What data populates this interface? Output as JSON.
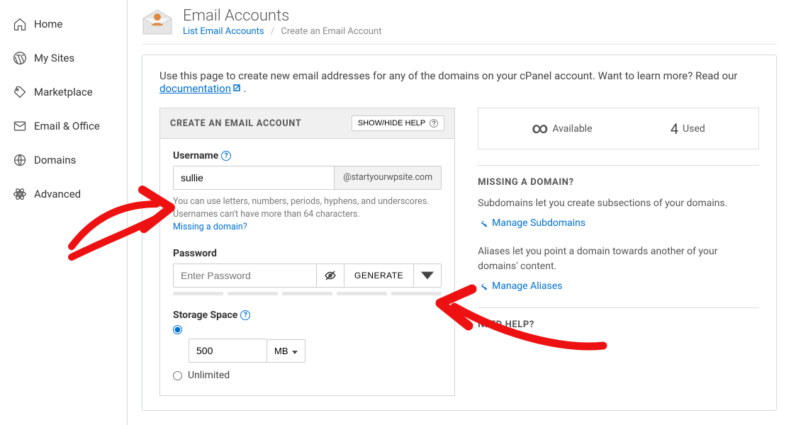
{
  "sidebar": {
    "items": [
      {
        "label": "Home"
      },
      {
        "label": "My Sites"
      },
      {
        "label": "Marketplace"
      },
      {
        "label": "Email & Office"
      },
      {
        "label": "Domains"
      },
      {
        "label": "Advanced"
      }
    ]
  },
  "header": {
    "title": "Email Accounts",
    "breadcrumb_link": "List Email Accounts",
    "breadcrumb_current": "Create an Email Account"
  },
  "intro": {
    "text_before": "Use this page to create new email addresses for any of the domains on your cPanel account. Want to learn more? Read our ",
    "link_text": "documentation",
    "text_after": " ."
  },
  "create": {
    "title": "CREATE AN EMAIL ACCOUNT",
    "help_btn": "SHOW/HIDE HELP",
    "username_label": "Username",
    "username_value": "sullie",
    "domain_addon": "@startyourwpsite.com",
    "username_hint": "You can use letters, numbers, periods, hyphens, and underscores. Usernames can't have more than 64 characters.",
    "missing_domain_link": "Missing a domain?",
    "password_label": "Password",
    "password_placeholder": "Enter Password",
    "generate_label": "GENERATE",
    "storage_label": "Storage Space",
    "storage_value": "500",
    "storage_unit": "MB",
    "unlimited_label": "Unlimited"
  },
  "stats": {
    "available_label": "Available",
    "used_value": "4",
    "used_label": "Used"
  },
  "missing": {
    "title": "MISSING A DOMAIN?",
    "sub_text": "Subdomains let you create subsections of your domains.",
    "sub_link": "Manage Subdomains",
    "alias_text": "Aliases let you point a domain towards another of your domains' content.",
    "alias_link": "Manage Aliases"
  },
  "help": {
    "title": "NEED HELP?"
  }
}
